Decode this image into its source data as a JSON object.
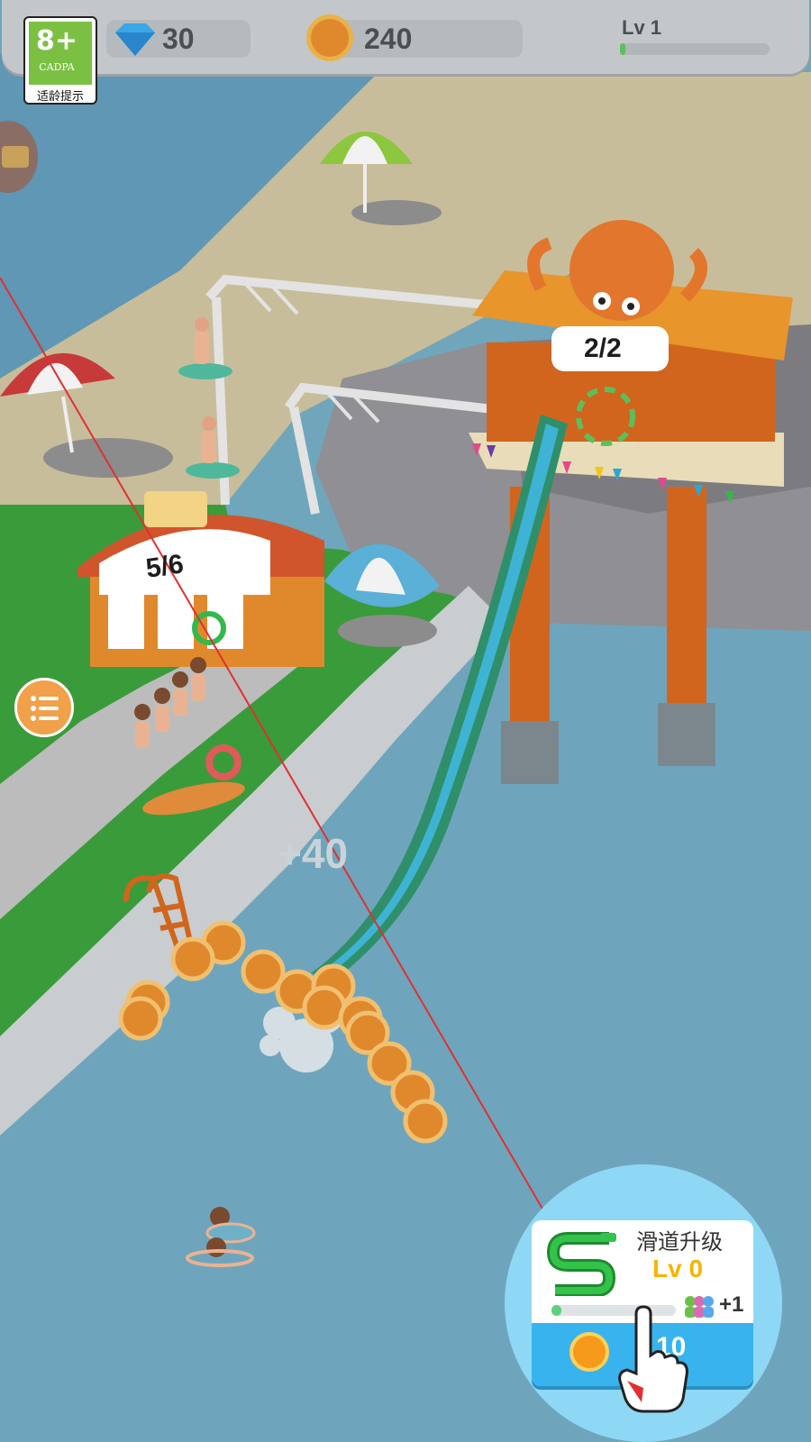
{
  "hud": {
    "gems": "30",
    "coins": "240",
    "level_label": "Lv 1",
    "level_progress": 0.03
  },
  "age_rating": {
    "age": "8+",
    "org": "CADPA",
    "tip": "适龄提示"
  },
  "world": {
    "ticket_booth_count": "5/6",
    "slide_tower_count": "2/2",
    "coin_popup": "+40"
  },
  "upgrade_card": {
    "title": "滑道升级",
    "level": "Lv 0",
    "progress": 0.08,
    "bonus": "+1",
    "price": "10"
  },
  "icons": [
    "gem-icon",
    "coin-icon",
    "treasure-chest-icon",
    "menu-list-icon",
    "slide-icon",
    "visitors-icon",
    "pointing-hand-icon"
  ],
  "colors": {
    "water": "#6fa6bc",
    "sand": "#c8bd9a",
    "grass": "#3a9b3a",
    "slide_accent": "#2fa7c9",
    "tower_orange": "#e0722c",
    "upgrade_button": "#38b3ee",
    "level_text": "#f5b400"
  }
}
